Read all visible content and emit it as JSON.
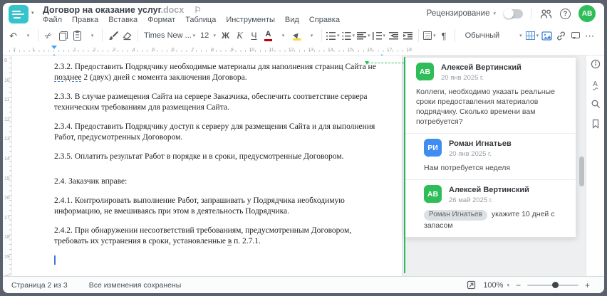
{
  "app": {
    "doc_title": "Договор на оказание услуг",
    "doc_ext": ".docx",
    "menu_items": [
      "Файл",
      "Правка",
      "Вставка",
      "Формат",
      "Таблица",
      "Инструменты",
      "Вид",
      "Справка"
    ],
    "review_mode_label": "Рецензирование",
    "user_initials": "АВ"
  },
  "icons": {
    "undo": "↶",
    "cut": "✂",
    "pilcrow": "¶",
    "more": "⋯",
    "caret": "▾",
    "flag": "⚐",
    "minus": "−",
    "plus": "+",
    "help": "?",
    "info": "i"
  },
  "toolbar": {
    "font_name": "Times New ...",
    "font_size": "12",
    "bold": "Ж",
    "italic": "К",
    "underline": "Ч",
    "color_letter": "А",
    "style_name": "Обычный"
  },
  "ruler": {
    "h_left_numbers": [
      "2",
      "1"
    ],
    "h_numbers": [
      "1",
      "2",
      "3",
      "4",
      "5",
      "6",
      "7",
      "8",
      "9",
      "10",
      "11",
      "12",
      "13",
      "14",
      "15",
      "16",
      "17",
      "18"
    ],
    "v_numbers": [
      "9",
      "10",
      "11",
      "12",
      "13",
      "14",
      "15",
      "16",
      "17",
      "18",
      "19",
      "20"
    ]
  },
  "document": {
    "paragraphs": [
      {
        "parts": [
          {
            "t": "2.3.2. Предоставить Подрядчику необходимые материалы для наполнения страниц Сайта не "
          },
          {
            "t": "позднее",
            "style": "tracked"
          },
          {
            "t": " 2 (двух) дней с момента заключения Договора."
          }
        ]
      },
      {
        "parts": [
          {
            "t": "2.3.3. В случае размещения Сайта на сервере Заказчика, обеспечить соответствие сервера техническим требованиям для размещения Сайта."
          }
        ]
      },
      {
        "parts": [
          {
            "t": "2.3.4. Предоставить Подрядчику доступ к серверу для размещения Сайта и для выполнения Работ, предусмотренных Договором."
          }
        ]
      },
      {
        "parts": [
          {
            "t": "2.3.5. Оплатить результат Работ в порядке и в сроки, предусмотренные Договором."
          }
        ]
      },
      {
        "parts": [
          {
            "t": "2.4. Заказчик вправе:"
          }
        ]
      },
      {
        "parts": [
          {
            "t": "2.4.1. Контролировать выполнение Работ, запрашивать у Подрядчика необходимую информацию, не вмешиваясь при этом в деятельность Подрядчика."
          }
        ]
      },
      {
        "parts": [
          {
            "t": "2.4.2. При обнаружении несоответствий требованиям, предусмотренным Договором, требовать их устранения в сроки, установленные "
          },
          {
            "t": "в",
            "style": "tracked"
          },
          {
            "t": " п. 2.7.1."
          }
        ]
      }
    ]
  },
  "comments": [
    {
      "initials": "АВ",
      "color": "#2ebd59",
      "name": "Алексей Вертинский",
      "date": "20 янв 2025 г.",
      "text": "Коллеги, необходимо указать реальные сроки предоставления материалов подрядчику. Сколько времени вам потребуется?",
      "reply": false
    },
    {
      "initials": "РИ",
      "color": "#3f8cf3",
      "name": "Роман Игнатьев",
      "date": "20 янв 2025 г.",
      "text": "Нам потребуется неделя",
      "reply": true
    },
    {
      "initials": "АВ",
      "color": "#2ebd59",
      "name": "Алексей Вертинский",
      "date": "26 май 2025 г.",
      "mention": "Роман Игнатьев",
      "text": "укажите 10 дней с запасом",
      "reply": true
    }
  ],
  "statusbar": {
    "page_info": "Страница 2 из 3",
    "save_status": "Все изменения сохранены",
    "zoom_value": "100%"
  },
  "colors": {
    "accent_teal": "#35c3cc",
    "comment_green": "#2bbf5c",
    "avatar_green": "#2ebd59",
    "avatar_blue": "#3f8cf3",
    "highlight_yellow": "#ffd83d",
    "font_color_red": "#c00000",
    "image_icon_blue": "#3d7fd6"
  }
}
